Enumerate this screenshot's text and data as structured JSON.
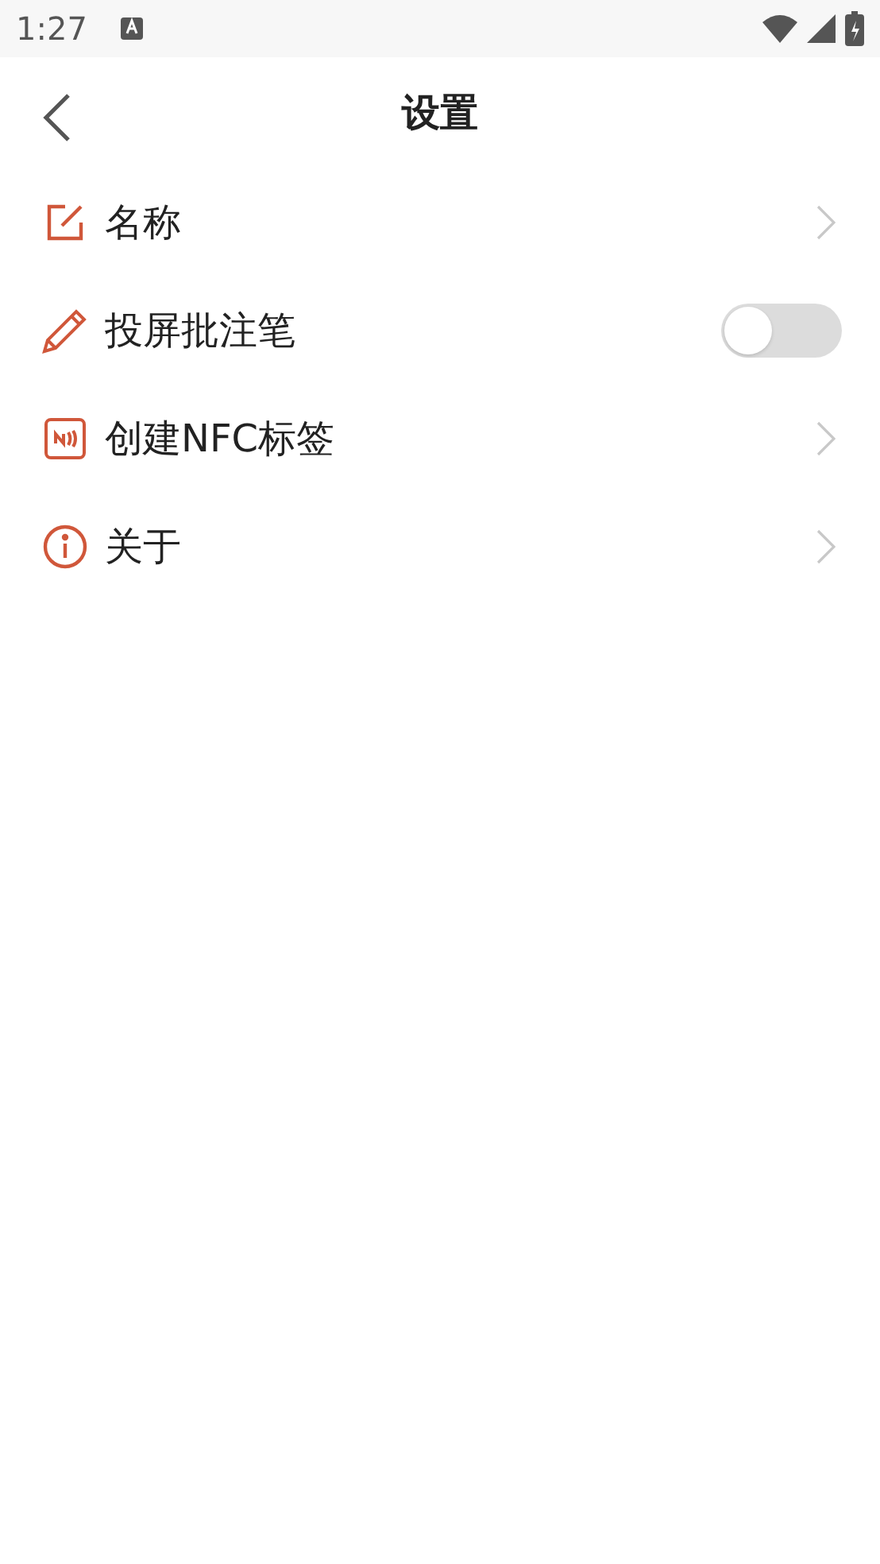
{
  "status_bar": {
    "time": "1:27"
  },
  "header": {
    "title": "设置"
  },
  "items": [
    {
      "kind": "link",
      "label": "名称"
    },
    {
      "kind": "toggle",
      "label": "投屏批注笔",
      "on": false
    },
    {
      "kind": "link",
      "label": "创建NFC标签"
    },
    {
      "kind": "link",
      "label": "关于"
    }
  ]
}
